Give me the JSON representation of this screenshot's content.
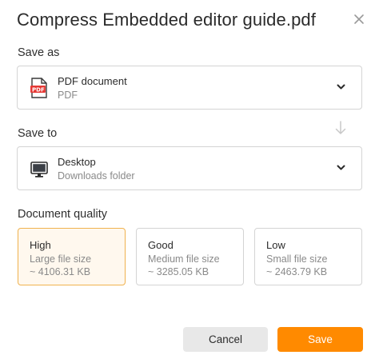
{
  "dialog": {
    "title": "Compress Embedded editor guide.pdf"
  },
  "save_as": {
    "label": "Save as",
    "selected_name": "PDF document",
    "selected_sub": "PDF",
    "icon": "pdf-file-icon"
  },
  "save_to": {
    "label": "Save to",
    "selected_name": "Desktop",
    "selected_sub": "Downloads folder",
    "icon": "desktop-monitor-icon"
  },
  "quality": {
    "label": "Document quality",
    "options": [
      {
        "name": "High",
        "desc": "Large file size",
        "size": "~ 4106.31 KB",
        "selected": true
      },
      {
        "name": "Good",
        "desc": "Medium file size",
        "size": "~ 3285.05 KB",
        "selected": false
      },
      {
        "name": "Low",
        "desc": "Small file size",
        "size": "~ 2463.79 KB",
        "selected": false
      }
    ]
  },
  "buttons": {
    "cancel": "Cancel",
    "save": "Save"
  },
  "colors": {
    "accent": "#ff8a00",
    "selected_border": "#f0b24e",
    "selected_bg": "#fff8ee",
    "pdf_red": "#e53935"
  }
}
